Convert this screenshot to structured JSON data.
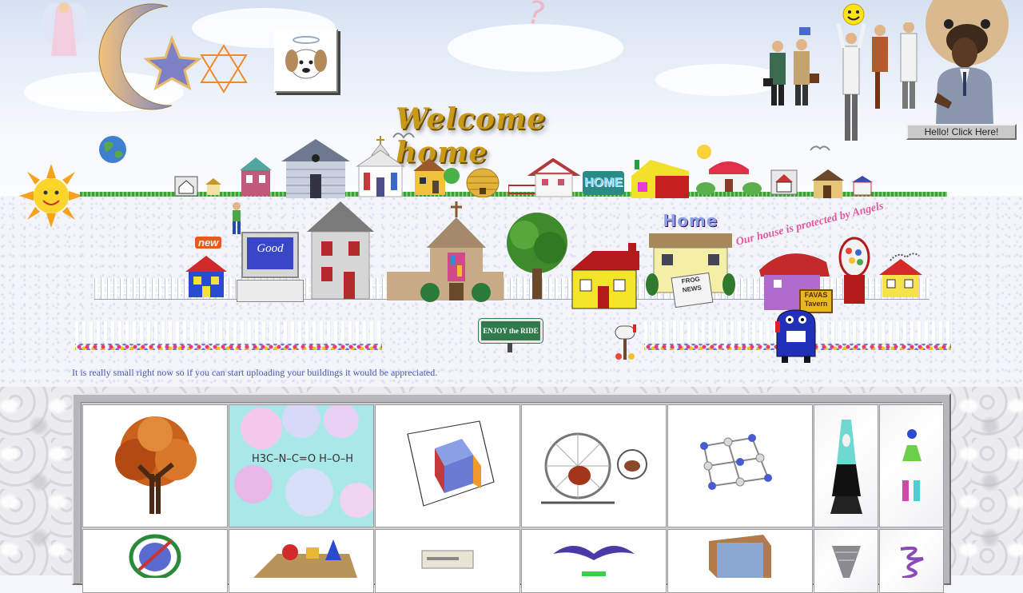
{
  "header": {
    "welcome_text": "Welcome home",
    "hello_button_label": "Hello!  Click Here!"
  },
  "signs": {
    "new_badge": "new",
    "computer_screen": "Good",
    "home_sign": "HOME",
    "home_roof_sign": "Home",
    "frog_news": "FROG NEWS",
    "favas_tavern": "FAVAS Tavern",
    "enjoy_ride": "ENJOY the RIDE",
    "angels_banner": "Our house is protected by Angels"
  },
  "note": "It is really small right now so if you can start uploading your buildings it would be appreciated.",
  "gallery": {
    "chem_molecule_text": "H3C–N–C=O  H–O–H",
    "row1": [
      "autumn tree",
      "chemistry molecules",
      "3d cube plot",
      "hamster wheel",
      "crystal lattice",
      "lava lamp",
      "chemistry flasks"
    ],
    "row2": [
      "atom orbit",
      "3d shapes",
      "desktop machine",
      "flying bird",
      "tv static box",
      "tornado",
      "spring coil"
    ]
  },
  "colors": {
    "link_text": "#4a55b8",
    "welcome_gold": "#c99a1a",
    "button_gray": "#c9c9c9"
  }
}
